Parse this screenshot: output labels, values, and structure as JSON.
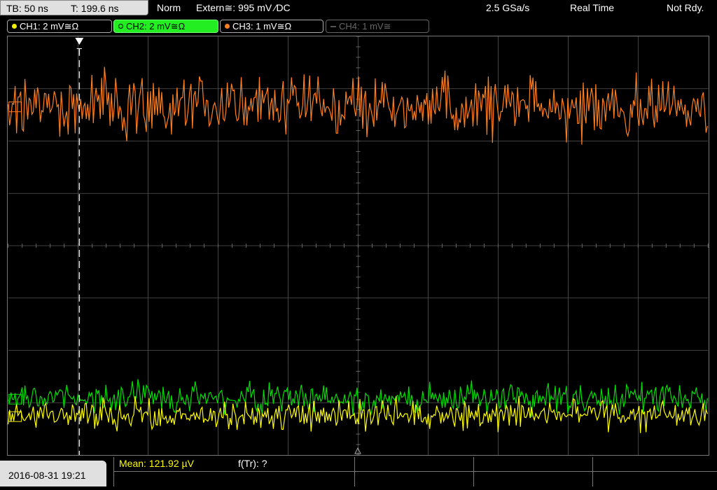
{
  "status": {
    "timebase": "TB: 50 ns",
    "trigger_time": "T: 199.6 ns",
    "mode": "Norm",
    "trigger_source": "Extern≅: 995 mV ⁄DC",
    "sample_rate": "2.5 GSa/s",
    "acq_mode": "Real Time",
    "state": "Not Rdy."
  },
  "channels": [
    {
      "label": "CH1: 2 mV≅Ω",
      "color": "#f0f000",
      "active": false
    },
    {
      "label": "CH2: 2 mV≅Ω",
      "color": "#00dd00",
      "active": true
    },
    {
      "label": "CH3: 1 mV≅Ω",
      "color": "#ff7f1e",
      "active": false
    },
    {
      "label": "CH4: 1 mV≅",
      "color": "#808080",
      "active": false
    }
  ],
  "measurements": {
    "mean": "Mean: 121.92 µV",
    "freq": "f(Tr): ?"
  },
  "footer": {
    "datetime": "2016-08-31 19:21"
  },
  "colors": {
    "ch1": "#ffff00",
    "ch2": "#00e000",
    "ch3": "#ff7f1e",
    "grid": "#555555"
  }
}
